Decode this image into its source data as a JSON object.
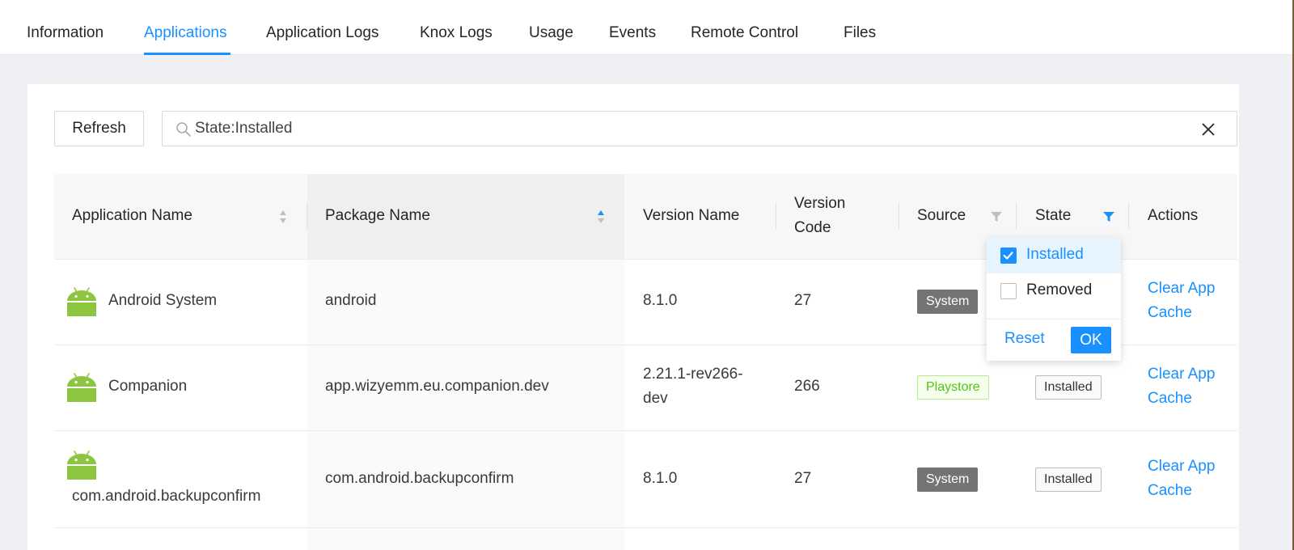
{
  "tabs": [
    {
      "label": "Information"
    },
    {
      "label": "Applications"
    },
    {
      "label": "Application Logs"
    },
    {
      "label": "Knox Logs"
    },
    {
      "label": "Usage"
    },
    {
      "label": "Events"
    },
    {
      "label": "Remote Control"
    },
    {
      "label": "Files"
    }
  ],
  "active_tab": "Applications",
  "toolbar": {
    "refresh_label": "Refresh",
    "search_value": "State:Installed"
  },
  "table": {
    "columns": {
      "app_name": "Application Name",
      "package_name": "Package Name",
      "version_name": "Version Name",
      "version_code_line1": "Version",
      "version_code_line2": "Code",
      "source": "Source",
      "state": "State",
      "actions": "Actions"
    },
    "rows": [
      {
        "app_name": "Android System",
        "package_name": "android",
        "version_name": "8.1.0",
        "version_code": "27",
        "source": "System",
        "action_line1": "Clear App",
        "action_line2": "Cache"
      },
      {
        "app_name": "Companion",
        "package_name": "app.wizyemm.eu.companion.dev",
        "version_name_line1": "2.21.1-rev266-",
        "version_name_line2": "dev",
        "version_code": "266",
        "source": "Playstore",
        "state": "Installed",
        "action_line1": "Clear App",
        "action_line2": "Cache"
      },
      {
        "app_name": "com.android.backupconfirm",
        "package_name": "com.android.backupconfirm",
        "version_name": "8.1.0",
        "version_code": "27",
        "source": "System",
        "state": "Installed",
        "action_line1": "Clear App",
        "action_line2": "Cache"
      }
    ]
  },
  "state_filter": {
    "options": [
      {
        "label": "Installed",
        "checked": true
      },
      {
        "label": "Removed",
        "checked": false
      }
    ],
    "reset_label": "Reset",
    "ok_label": "OK"
  },
  "colors": {
    "accent": "#1890ff",
    "system_tag": "#747474",
    "playstore_tag": "#52c41a",
    "android_green": "#8cc63f"
  },
  "icons": {
    "search": "search-icon",
    "clear": "close-icon",
    "sort": "sort-icon",
    "filter": "filter-icon",
    "app": "android-icon",
    "checkbox": "check-icon"
  }
}
